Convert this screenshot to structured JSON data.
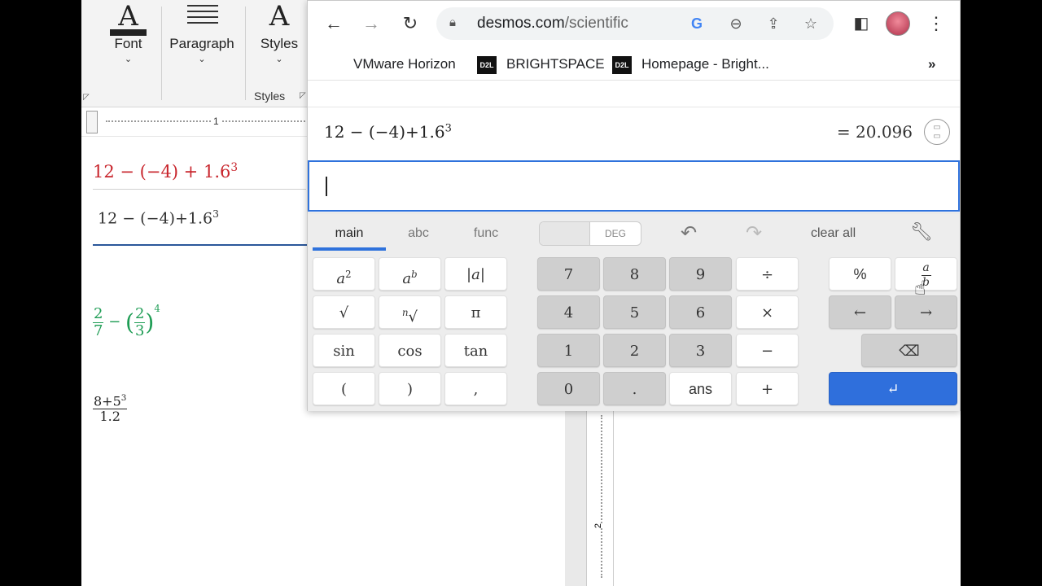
{
  "word": {
    "ribbon": {
      "font_label": "Font",
      "paragraph_label": "Paragraph",
      "styles_label": "Styles",
      "styles_group_caption": "Styles"
    },
    "ruler_number": "1",
    "vruler_number": "2",
    "equations": {
      "eq1": "12 − (−4) + 1.6",
      "eq1_exp": "3",
      "eq2": "12 − (−4)+1.6",
      "eq2_exp": "3",
      "eq3_frac1_num": "2",
      "eq3_frac1_den": "7",
      "eq3_minus": "−",
      "eq3_frac2_num": "2",
      "eq3_frac2_den": "3",
      "eq3_exp": "4",
      "eq4_num": "8+5",
      "eq4_num_exp": "3",
      "eq4_den": "1.2"
    }
  },
  "browser": {
    "url_host": "desmos.com",
    "url_path": "/scientific",
    "bookmarks": [
      "VMware Horizon",
      "BRIGHTSPACE",
      "Homepage - Bright..."
    ],
    "d2l_badge": "D2L",
    "more": "»"
  },
  "desmos": {
    "expression": "12 − (−4)+1.6",
    "expression_exp": "3",
    "result": "= 20.096",
    "tabs": [
      "main",
      "abc",
      "func"
    ],
    "deg_label": "DEG",
    "clear_all": "clear all",
    "keys": {
      "pi": "π",
      "sin": "sin",
      "cos": "cos",
      "tan": "tan",
      "lparen": "(",
      "rparen": ")",
      "comma": ",",
      "n7": "7",
      "n8": "8",
      "n9": "9",
      "div": "÷",
      "n4": "4",
      "n5": "5",
      "n6": "6",
      "times": "×",
      "n1": "1",
      "n2": "2",
      "n3": "3",
      "minus": "−",
      "n0": "0",
      "dot": ".",
      "ans": "ans",
      "plus": "+",
      "percent": "%",
      "left": "←",
      "right": "→"
    }
  }
}
